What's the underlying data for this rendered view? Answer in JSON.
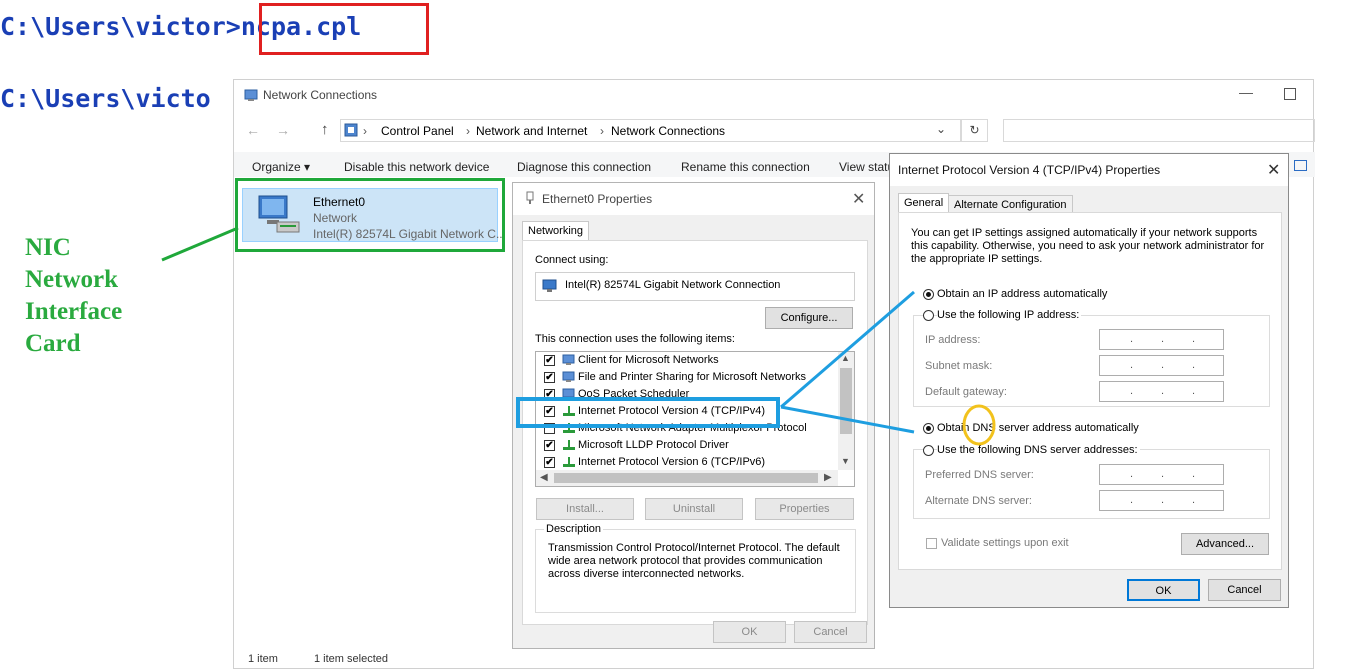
{
  "terminal": {
    "line1_prompt": "C:\\Users\\victor",
    "line1_arrow": ">",
    "line1_command": "ncpa.cpl",
    "line2_prompt": "C:\\Users\\victo"
  },
  "annotation": {
    "nic_lines": [
      "NIC",
      "Network",
      "Interface",
      "Card"
    ],
    "colors": {
      "red": "#e02020",
      "green": "#1fa83a",
      "blue": "#1e9ee0",
      "yellow": "#f2c21c"
    }
  },
  "network_connections": {
    "title": "Network Connections",
    "breadcrumb": [
      "Control Panel",
      "Network and Internet",
      "Network Connections"
    ],
    "toolbar": [
      "Organize",
      "Disable this network device",
      "Diagnose this connection",
      "Rename this connection",
      "View statu"
    ],
    "adapter": {
      "name": "Ethernet0",
      "type": "Network",
      "device": "Intel(R) 82574L Gigabit Network C..."
    },
    "status": {
      "count": "1 item",
      "selected": "1 item selected"
    }
  },
  "ethernet_props": {
    "title": "Ethernet0 Properties",
    "tab": "Networking",
    "connect_using_label": "Connect using:",
    "adapter": "Intel(R) 82574L Gigabit Network Connection",
    "configure": "Configure...",
    "items_label": "This connection uses the following items:",
    "items": [
      {
        "label": "Client for Microsoft Networks",
        "checked": true
      },
      {
        "label": "File and Printer Sharing for Microsoft Networks",
        "checked": true
      },
      {
        "label": "QoS Packet Scheduler",
        "checked": true
      },
      {
        "label": "Internet Protocol Version 4 (TCP/IPv4)",
        "checked": true
      },
      {
        "label": "Microsoft Network Adapter Multiplexor Protocol",
        "checked": false
      },
      {
        "label": "Microsoft LLDP Protocol Driver",
        "checked": true
      },
      {
        "label": "Internet Protocol Version 6 (TCP/IPv6)",
        "checked": true
      }
    ],
    "install": "Install...",
    "uninstall": "Uninstall",
    "properties": "Properties",
    "description_label": "Description",
    "description": "Transmission Control Protocol/Internet Protocol. The default wide area network protocol that provides communication across diverse interconnected networks.",
    "ok": "OK",
    "cancel": "Cancel"
  },
  "ipv4_props": {
    "title": "Internet Protocol Version 4 (TCP/IPv4) Properties",
    "tabs": [
      "General",
      "Alternate Configuration"
    ],
    "intro": "You can get IP settings assigned automatically if your network supports this capability. Otherwise, you need to ask your network administrator for the appropriate IP settings.",
    "obtain_ip": "Obtain an IP address automatically",
    "use_ip": "Use the following IP address:",
    "ip_address": "IP address:",
    "subnet_mask": "Subnet mask:",
    "default_gateway": "Default gateway:",
    "obtain_dns_a": "Obtain ",
    "obtain_dns_b": "DNS",
    "obtain_dns_c": " server address automatically",
    "use_dns": "Use the following DNS server addresses:",
    "preferred_dns": "Preferred DNS server:",
    "alternate_dns": "Alternate DNS server:",
    "validate": "Validate settings upon exit",
    "advanced": "Advanced...",
    "ok": "OK",
    "cancel": "Cancel",
    "ip_dot": "."
  }
}
